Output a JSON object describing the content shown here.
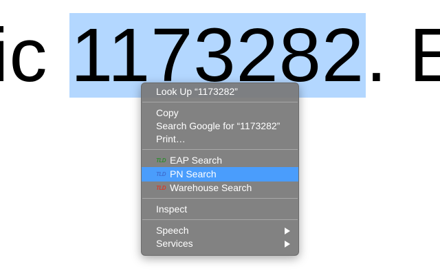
{
  "document": {
    "text_before": "ic ",
    "selected": "1173282",
    "text_after": ". E"
  },
  "context_menu": {
    "look_up": "Look Up “1173282”",
    "copy": "Copy",
    "search_google": "Search Google for “1173282”",
    "print": "Print…",
    "extensions": [
      {
        "icon": "TLD",
        "icon_color": "#2e8b2e",
        "label": "EAP Search"
      },
      {
        "icon": "TLD",
        "icon_color": "#3f6fd0",
        "label": "PN Search",
        "highlighted": true
      },
      {
        "icon": "TLD",
        "icon_color": "#d23c2c",
        "label": "Warehouse Search"
      }
    ],
    "inspect": "Inspect",
    "speech": "Speech",
    "services": "Services",
    "highlight_color": "#4a9dfc",
    "selection_color": "#b3d7ff"
  }
}
